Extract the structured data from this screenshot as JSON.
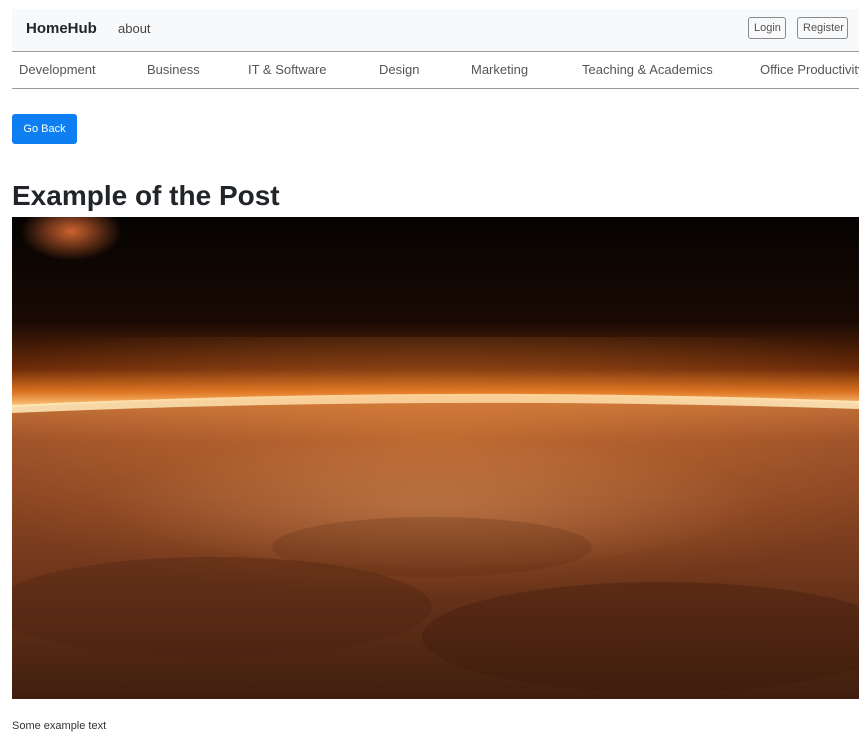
{
  "navbar": {
    "brand": "HomeHub",
    "about": "about",
    "login": "Login",
    "register": "Register"
  },
  "categories": [
    "Development",
    "Business",
    "IT & Software",
    "Design",
    "Marketing",
    "Teaching & Academics",
    "Office Productivity"
  ],
  "post": {
    "back_button": "Go Back",
    "title": "Example of the Post",
    "body": "Some example text"
  },
  "colors": {
    "primary": "#0d7ff3",
    "navbar_bg": "#f8f9fa"
  }
}
